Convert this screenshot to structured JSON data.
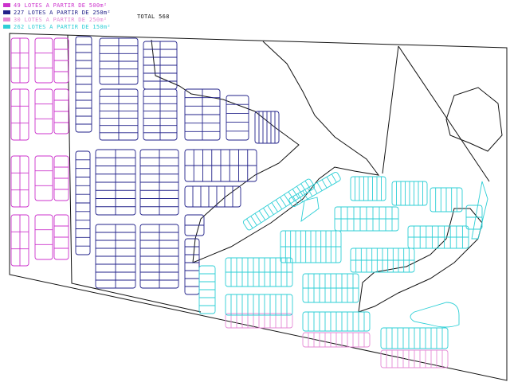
{
  "legend": [
    {
      "text": "49 LOTES A PARTIR DE 500m²",
      "color": "#cc33cc"
    },
    {
      "text": "227 LOTES A PARTIR DE 250m²",
      "color": "#22228a"
    },
    {
      "text": "30 LOTES A PARTIR DE 250m²",
      "color": "#e58ad6"
    },
    {
      "text": "262 LOTES A PARTIR DE 150m²",
      "color": "#2ecfd6"
    }
  ],
  "total": "TOTAL 568",
  "colors": {
    "outline": "#111111",
    "lots_500": "#cc33cc",
    "lots_250": "#22228a",
    "lots_250_alt": "#e58ad6",
    "lots_150": "#2ecfd6"
  }
}
